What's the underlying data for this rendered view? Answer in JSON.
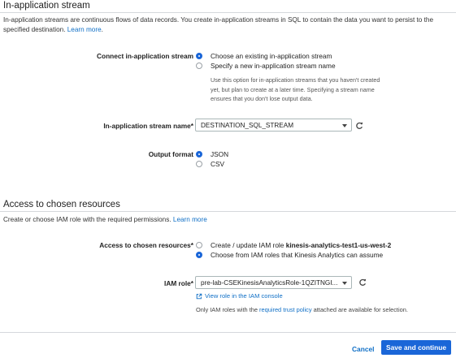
{
  "section1": {
    "title": "In-application stream",
    "description": "In-application streams are continuous flows of data records. You create in-application streams in SQL to contain the data you want to persist to the specified destination.",
    "learn_more": "Learn more",
    "connect_label": "Connect in-application stream",
    "connect_options": [
      "Choose an existing in-application stream",
      "Specify a new in-application stream name"
    ],
    "connect_hint": "Use this option for in-application streams that you haven't created yet, but plan to create at a later time. Specifying a stream name ensures that you don't lose output data.",
    "stream_name_label": "In-application stream name*",
    "stream_name_value": "DESTINATION_SQL_STREAM",
    "output_format_label": "Output format",
    "output_format_options": [
      "JSON",
      "CSV"
    ]
  },
  "section2": {
    "title": "Access to chosen resources",
    "description": "Create or choose IAM role with the required permissions.",
    "learn_more": "Learn more",
    "access_label": "Access to chosen resources*",
    "access_option1_prefix": "Create / update IAM role ",
    "access_option1_role": "kinesis-analytics-test1-us-west-2",
    "access_option2": "Choose from IAM roles that Kinesis Analytics can assume",
    "iam_role_label": "IAM role*",
    "iam_role_value": "pre-lab-CSEKinesisAnalyticsRole-1QZITNGI...",
    "view_role_link": "View role in the IAM console",
    "trust_note_prefix": "Only IAM roles with the ",
    "trust_note_link": "required trust policy",
    "trust_note_suffix": " attached are available for selection."
  },
  "footer": {
    "cancel_label": "Cancel",
    "save_label": "Save and continue"
  },
  "colors": {
    "accent": "#1a66d8",
    "link": "#0f6fc6",
    "divider": "#d5d8dc"
  },
  "icons": {
    "refresh": "refresh-icon",
    "external_link": "external-link-icon",
    "dropdown": "chevron-down-icon"
  }
}
